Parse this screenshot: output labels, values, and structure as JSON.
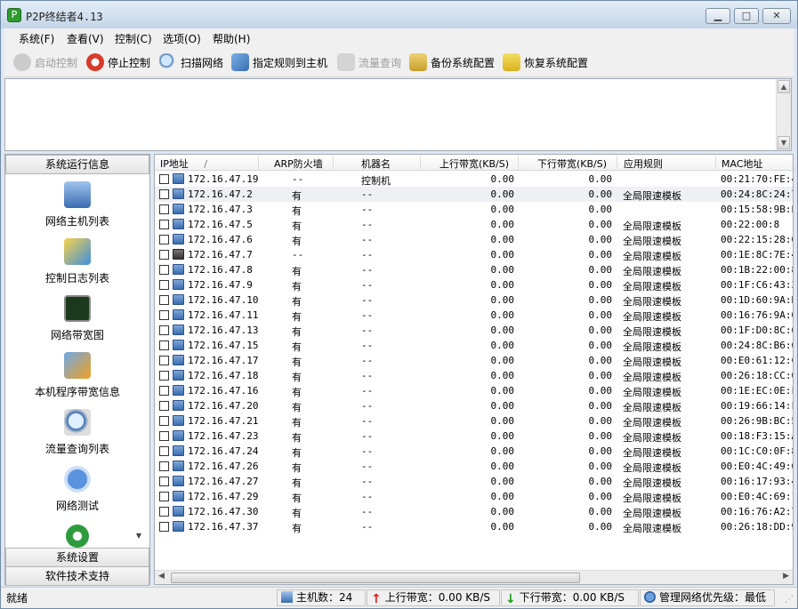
{
  "window": {
    "title": "P2P终结者4.13",
    "app_icon": "app-logo-icon",
    "minimize": "minimize-icon",
    "maximize": "maximize-icon",
    "close": "close-icon"
  },
  "menu": [
    {
      "label": "系统(F)"
    },
    {
      "label": "查看(V)"
    },
    {
      "label": "控制(C)"
    },
    {
      "label": "选项(O)"
    },
    {
      "label": "帮助(H)"
    }
  ],
  "toolbar": {
    "start": {
      "label": "启动控制",
      "icon": "start-control-icon",
      "disabled": true
    },
    "stop": {
      "label": "停止控制",
      "icon": "stop-control-icon"
    },
    "scan": {
      "label": "扫描网络",
      "icon": "scan-network-icon"
    },
    "assign": {
      "label": "指定规则到主机",
      "icon": "assign-rule-icon"
    },
    "traffic": {
      "label": "流量查询",
      "icon": "traffic-query-icon",
      "disabled": true
    },
    "backup": {
      "label": "备份系统配置",
      "icon": "backup-config-icon"
    },
    "restore": {
      "label": "恢复系统配置",
      "icon": "restore-config-icon"
    }
  },
  "sidebar": {
    "header": "系统运行信息",
    "items": [
      {
        "label": "网络主机列表",
        "icon": "network-hosts-icon"
      },
      {
        "label": "控制日志列表",
        "icon": "control-log-icon"
      },
      {
        "label": "网络带宽图",
        "icon": "bandwidth-chart-icon"
      },
      {
        "label": "本机程序带宽信息",
        "icon": "local-program-icon"
      },
      {
        "label": "流量查询列表",
        "icon": "traffic-list-icon"
      },
      {
        "label": "网络测试",
        "icon": "network-test-icon"
      },
      {
        "label": "",
        "icon": "settings-gear-icon"
      }
    ],
    "footer1": "系统设置",
    "footer2": "软件技术支持"
  },
  "table": {
    "columns": [
      "IP地址",
      "ARP防火墙",
      "机器名",
      "上行带宽(KB/S)",
      "下行带宽(KB/S)",
      "应用规则",
      "MAC地址"
    ],
    "sort_indicator": "/",
    "rows": [
      {
        "ip": "172.16.47.19",
        "arp": "--",
        "name": "控制机",
        "up": "0.00",
        "down": "0.00",
        "rule": "",
        "mac": "00:21:70:FE:4"
      },
      {
        "ip": "172.16.47.2",
        "arp": "有",
        "name": "--",
        "up": "0.00",
        "down": "0.00",
        "rule": "全局限速模板",
        "mac": "00:24:8C:24:7"
      },
      {
        "ip": "172.16.47.3",
        "arp": "有",
        "name": "--",
        "up": "0.00",
        "down": "0.00",
        "rule": "",
        "mac": "00:15:58:9B:E"
      },
      {
        "ip": "172.16.47.5",
        "arp": "有",
        "name": "--",
        "up": "0.00",
        "down": "0.00",
        "rule": "全局限速模板",
        "mac": "00:22:00:8"
      },
      {
        "ip": "172.16.47.6",
        "arp": "有",
        "name": "--",
        "up": "0.00",
        "down": "0.00",
        "rule": "全局限速模板",
        "mac": "00:22:15:28:0"
      },
      {
        "ip": "172.16.47.7",
        "arp": "--",
        "name": "--",
        "up": "0.00",
        "down": "0.00",
        "rule": "全局限速模板",
        "mac": "00:1E:8C:7E:4"
      },
      {
        "ip": "172.16.47.8",
        "arp": "有",
        "name": "--",
        "up": "0.00",
        "down": "0.00",
        "rule": "全局限速模板",
        "mac": "00:1B:22:00:8"
      },
      {
        "ip": "172.16.47.9",
        "arp": "有",
        "name": "--",
        "up": "0.00",
        "down": "0.00",
        "rule": "全局限速模板",
        "mac": "00:1F:C6:43:3"
      },
      {
        "ip": "172.16.47.10",
        "arp": "有",
        "name": "--",
        "up": "0.00",
        "down": "0.00",
        "rule": "全局限速模板",
        "mac": "00:1D:60:9A:B"
      },
      {
        "ip": "172.16.47.11",
        "arp": "有",
        "name": "--",
        "up": "0.00",
        "down": "0.00",
        "rule": "全局限速模板",
        "mac": "00:16:76:9A:0"
      },
      {
        "ip": "172.16.47.13",
        "arp": "有",
        "name": "--",
        "up": "0.00",
        "down": "0.00",
        "rule": "全局限速模板",
        "mac": "00:1F:D0:8C:6"
      },
      {
        "ip": "172.16.47.15",
        "arp": "有",
        "name": "--",
        "up": "0.00",
        "down": "0.00",
        "rule": "全局限速模板",
        "mac": "00:24:8C:B6:6"
      },
      {
        "ip": "172.16.47.17",
        "arp": "有",
        "name": "--",
        "up": "0.00",
        "down": "0.00",
        "rule": "全局限速模板",
        "mac": "00:E0:61:12:C"
      },
      {
        "ip": "172.16.47.18",
        "arp": "有",
        "name": "--",
        "up": "0.00",
        "down": "0.00",
        "rule": "全局限速模板",
        "mac": "00:26:18:CC:0"
      },
      {
        "ip": "172.16.47.16",
        "arp": "有",
        "name": "--",
        "up": "0.00",
        "down": "0.00",
        "rule": "全局限速模板",
        "mac": "00:1E:EC:0E:F"
      },
      {
        "ip": "172.16.47.20",
        "arp": "有",
        "name": "--",
        "up": "0.00",
        "down": "0.00",
        "rule": "全局限速模板",
        "mac": "00:19:66:14:F"
      },
      {
        "ip": "172.16.47.21",
        "arp": "有",
        "name": "--",
        "up": "0.00",
        "down": "0.00",
        "rule": "全局限速模板",
        "mac": "00:26:9B:BC:5"
      },
      {
        "ip": "172.16.47.23",
        "arp": "有",
        "name": "--",
        "up": "0.00",
        "down": "0.00",
        "rule": "全局限速模板",
        "mac": "00:18:F3:15:A"
      },
      {
        "ip": "172.16.47.24",
        "arp": "有",
        "name": "--",
        "up": "0.00",
        "down": "0.00",
        "rule": "全局限速模板",
        "mac": "00:1C:C0:0F:8"
      },
      {
        "ip": "172.16.47.26",
        "arp": "有",
        "name": "--",
        "up": "0.00",
        "down": "0.00",
        "rule": "全局限速模板",
        "mac": "00:E0:4C:49:6"
      },
      {
        "ip": "172.16.47.27",
        "arp": "有",
        "name": "--",
        "up": "0.00",
        "down": "0.00",
        "rule": "全局限速模板",
        "mac": "00:16:17:93:4"
      },
      {
        "ip": "172.16.47.29",
        "arp": "有",
        "name": "--",
        "up": "0.00",
        "down": "0.00",
        "rule": "全局限速模板",
        "mac": "00:E0:4C:69:1"
      },
      {
        "ip": "172.16.47.30",
        "arp": "有",
        "name": "--",
        "up": "0.00",
        "down": "0.00",
        "rule": "全局限速模板",
        "mac": "00:16:76:A2:7"
      },
      {
        "ip": "172.16.47.37",
        "arp": "有",
        "name": "--",
        "up": "0.00",
        "down": "0.00",
        "rule": "全局限速模板",
        "mac": "00:26:18:DD:9"
      }
    ]
  },
  "status": {
    "ready": "就绪",
    "hosts": "主机数：24",
    "up": "上行带宽：0.00 KB/S",
    "down": "下行带宽：0.00 KB/S",
    "priority": "管理网络优先级：最低"
  },
  "colors": {
    "accent": "#3a6db0",
    "up_arrow": "#e02020",
    "down_arrow": "#1e9a1e"
  }
}
